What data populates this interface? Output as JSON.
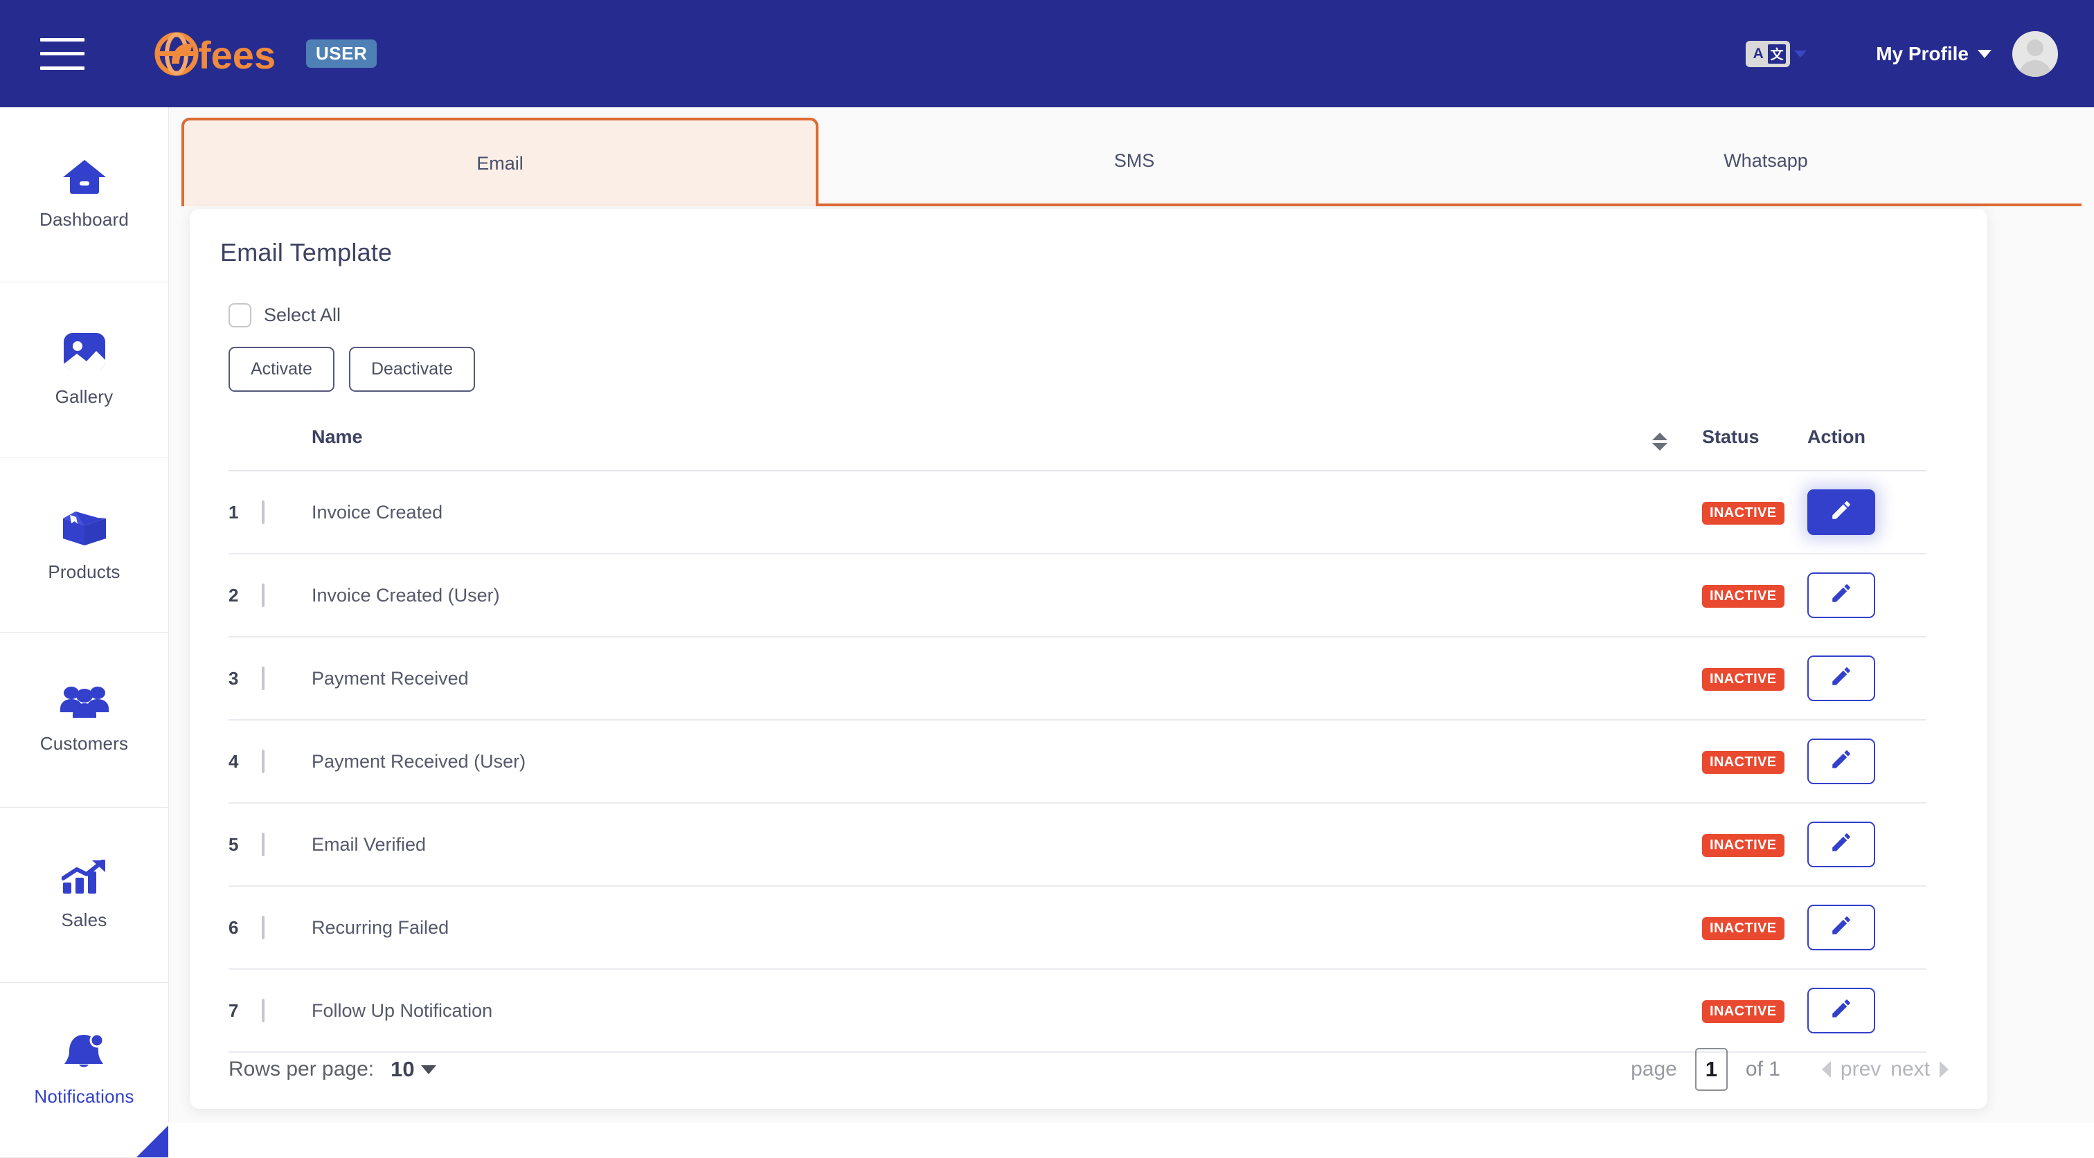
{
  "topbar": {
    "menu_icon": "hamburger-icon",
    "brand_name": "Fees",
    "brand_badge": "USER",
    "translate_icon": "translate-icon",
    "translate_a": "A",
    "translate_cjk": "文",
    "profile_label": "My Profile",
    "avatar_icon": "user-avatar-icon",
    "bg_color": "#262C8F",
    "brand_color": "#F08A3C",
    "badge_color": "#4E7FB5"
  },
  "sidebar": {
    "items": [
      {
        "label": "Dashboard",
        "icon": "home-icon",
        "active": false
      },
      {
        "label": "Gallery",
        "icon": "image-icon",
        "active": false
      },
      {
        "label": "Products",
        "icon": "box-icon",
        "active": false
      },
      {
        "label": "Customers",
        "icon": "users-icon",
        "active": false
      },
      {
        "label": "Sales",
        "icon": "chart-growth-icon",
        "active": false
      },
      {
        "label": "Notifications",
        "icon": "bell-icon",
        "active": true
      }
    ],
    "active_color": "#3340CC"
  },
  "tabs": [
    {
      "label": "Email",
      "active": true
    },
    {
      "label": "SMS",
      "active": false
    },
    {
      "label": "Whatsapp",
      "active": false
    }
  ],
  "tab_accent_color": "#DD6B34",
  "card": {
    "title": "Email Template",
    "select_all_label": "Select All",
    "select_all_checked": false,
    "activate_label": "Activate",
    "deactivate_label": "Deactivate"
  },
  "table": {
    "headers": {
      "index": "",
      "checkbox": "",
      "name": "Name",
      "sort_icon": "sort-updown-icon",
      "status": "Status",
      "action": "Action"
    },
    "rows": [
      {
        "index": "1",
        "name": "Invoice Created",
        "status": "INACTIVE",
        "checked": false,
        "action_icon": "edit-pencil-icon",
        "action_active": true
      },
      {
        "index": "2",
        "name": "Invoice Created (User)",
        "status": "INACTIVE",
        "checked": false,
        "action_icon": "edit-pencil-icon",
        "action_active": false
      },
      {
        "index": "3",
        "name": "Payment Received",
        "status": "INACTIVE",
        "checked": false,
        "action_icon": "edit-pencil-icon",
        "action_active": false
      },
      {
        "index": "4",
        "name": "Payment Received (User)",
        "status": "INACTIVE",
        "checked": false,
        "action_icon": "edit-pencil-icon",
        "action_active": false
      },
      {
        "index": "5",
        "name": "Email Verified",
        "status": "INACTIVE",
        "checked": false,
        "action_icon": "edit-pencil-icon",
        "action_active": false
      },
      {
        "index": "6",
        "name": "Recurring Failed",
        "status": "INACTIVE",
        "checked": false,
        "action_icon": "edit-pencil-icon",
        "action_active": false
      },
      {
        "index": "7",
        "name": "Follow Up Notification",
        "status": "INACTIVE",
        "checked": false,
        "action_icon": "edit-pencil-icon",
        "action_active": false
      }
    ],
    "status_color": "#E8492F",
    "action_color": "#3340CC"
  },
  "pagination": {
    "rows_per_page_label": "Rows per page:",
    "rows_per_page_value": "10",
    "page_label": "page",
    "page_value": "1",
    "of_label": "of 1",
    "prev_label": "prev",
    "next_label": "next"
  }
}
